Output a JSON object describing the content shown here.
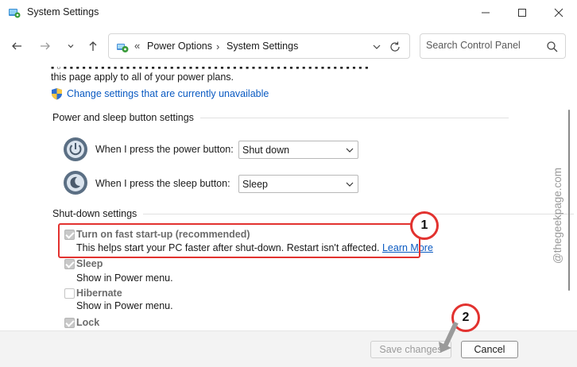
{
  "window": {
    "title": "System Settings"
  },
  "nav": {
    "breadcrumb": [
      "Power Options",
      "System Settings"
    ],
    "search_placeholder": "Search Control Panel"
  },
  "content": {
    "intro_text": "this page apply to all of your power plans.",
    "change_settings_link": "Change settings that are currently unavailable",
    "power_sleep": {
      "header": "Power and sleep button settings",
      "power_label": "When I press the power button:",
      "power_value": "Shut down",
      "sleep_label": "When I press the sleep button:",
      "sleep_value": "Sleep"
    },
    "shutdown": {
      "header": "Shut-down settings",
      "items": [
        {
          "label": "Turn on fast start-up (recommended)",
          "desc": "This helps start your PC faster after shut-down. Restart isn't affected.",
          "link": "Learn More",
          "checked": true
        },
        {
          "label": "Sleep",
          "desc": "Show in Power menu.",
          "checked": true
        },
        {
          "label": "Hibernate",
          "desc": "Show in Power menu.",
          "checked": false
        },
        {
          "label": "Lock",
          "checked": true
        }
      ]
    }
  },
  "annotations": {
    "badge1": "1",
    "badge2": "2",
    "color": "#e2322f"
  },
  "watermark": "@thegeekpage.com",
  "footer": {
    "save_label": "Save changes",
    "cancel_label": "Cancel"
  },
  "colors": {
    "link": "#0a5ac2",
    "accent_red": "#e2322f"
  },
  "icons": [
    "app-icon",
    "minimize-icon",
    "maximize-icon",
    "close-icon",
    "back-arrow-icon",
    "forward-arrow-icon",
    "chevron-down-icon",
    "up-arrow-icon",
    "control-panel-icon",
    "refresh-icon",
    "search-icon",
    "shield-icon",
    "power-button-icon",
    "sleep-button-icon"
  ]
}
